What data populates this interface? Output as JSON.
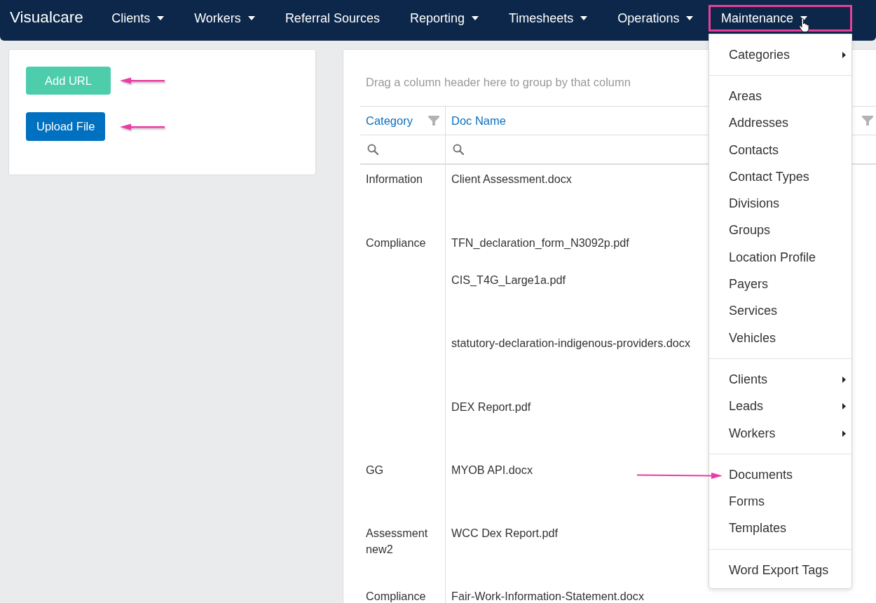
{
  "navbar": {
    "brand": "Visualcare",
    "items": [
      {
        "label": "Clients",
        "dropdown": true,
        "open": false,
        "annotated": false
      },
      {
        "label": "Workers",
        "dropdown": true,
        "open": false,
        "annotated": false
      },
      {
        "label": "Referral Sources",
        "dropdown": false,
        "open": false,
        "annotated": false
      },
      {
        "label": "Reporting",
        "dropdown": true,
        "open": false,
        "annotated": false
      },
      {
        "label": "Timesheets",
        "dropdown": true,
        "open": false,
        "annotated": false
      },
      {
        "label": "Operations",
        "dropdown": true,
        "open": false,
        "annotated": false
      },
      {
        "label": "Maintenance",
        "dropdown": true,
        "open": true,
        "annotated": true,
        "menu": {
          "sections": [
            [
              {
                "label": "Categories",
                "submenu": true,
                "annotated": false
              }
            ],
            [
              {
                "label": "Areas",
                "submenu": false,
                "annotated": false
              },
              {
                "label": "Addresses",
                "submenu": false,
                "annotated": false
              },
              {
                "label": "Contacts",
                "submenu": false,
                "annotated": false
              },
              {
                "label": "Contact Types",
                "submenu": false,
                "annotated": false
              },
              {
                "label": "Divisions",
                "submenu": false,
                "annotated": false
              },
              {
                "label": "Groups",
                "submenu": false,
                "annotated": false
              },
              {
                "label": "Location Profile",
                "submenu": false,
                "annotated": false
              },
              {
                "label": "Payers",
                "submenu": false,
                "annotated": false
              },
              {
                "label": "Services",
                "submenu": false,
                "annotated": false
              },
              {
                "label": "Vehicles",
                "submenu": false,
                "annotated": false
              }
            ],
            [
              {
                "label": "Clients",
                "submenu": true,
                "annotated": false
              },
              {
                "label": "Leads",
                "submenu": true,
                "annotated": false
              },
              {
                "label": "Workers",
                "submenu": true,
                "annotated": false
              }
            ],
            [
              {
                "label": "Documents",
                "submenu": false,
                "annotated": true
              },
              {
                "label": "Forms",
                "submenu": false,
                "annotated": false
              },
              {
                "label": "Templates",
                "submenu": false,
                "annotated": false
              }
            ],
            [
              {
                "label": "Word Export Tags",
                "submenu": false,
                "annotated": false
              }
            ]
          ]
        }
      }
    ]
  },
  "action_card": {
    "buttons": [
      {
        "label": "Add URL",
        "kind": "secondary",
        "annotated": true
      },
      {
        "label": "Upload File",
        "kind": "primary",
        "annotated": true
      }
    ]
  },
  "documents_grid": {
    "group_panel_hint": "Drag a column header here to group by that column",
    "columns": [
      {
        "label": "Category",
        "filter": true,
        "search": true
      },
      {
        "label": "Doc Name",
        "filter": false,
        "search": true
      },
      {
        "filter": true,
        "search": false
      }
    ],
    "rows": [
      {
        "category": "Information",
        "doc_name": "Client Assessment.docx"
      },
      {
        "category": "Compliance",
        "doc_name": "TFN_declaration_form_N3092p.pdf"
      },
      {
        "doc_name": "CIS_T4G_Large1a.pdf"
      },
      {
        "doc_name": "statutory-declaration-indigenous-providers.docx"
      },
      {
        "doc_name": "DEX Report.pdf"
      },
      {
        "category": "GG",
        "doc_name": "MYOB API.docx"
      },
      {
        "category": "Assessment new2",
        "doc_name": "WCC Dex Report.pdf"
      },
      {
        "category": "Compliance",
        "doc_name": "Fair-Work-Information-Statement.docx"
      }
    ]
  }
}
